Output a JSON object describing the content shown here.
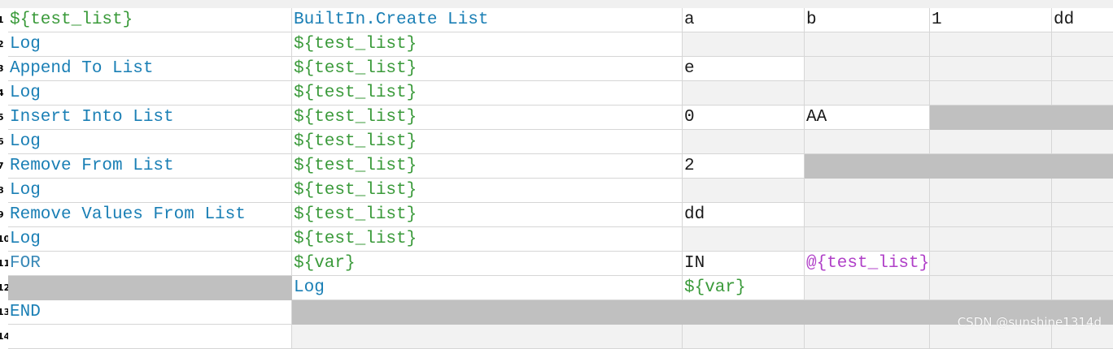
{
  "rows": [
    {
      "num": "1",
      "cells": [
        {
          "text": "${test_list}",
          "style": "var",
          "bg": "white"
        },
        {
          "text": "BuiltIn.Create List",
          "style": "kw",
          "bg": "white"
        },
        {
          "text": "a",
          "style": "plain",
          "bg": "white"
        },
        {
          "text": "b",
          "style": "plain",
          "bg": "white"
        },
        {
          "text": "1",
          "style": "plain",
          "bg": "white"
        },
        {
          "text": "dd",
          "style": "plain",
          "bg": "white"
        }
      ]
    },
    {
      "num": "2",
      "cells": [
        {
          "text": "Log",
          "style": "kw",
          "bg": "white"
        },
        {
          "text": "${test_list}",
          "style": "var",
          "bg": "white"
        },
        {
          "text": "",
          "style": "plain",
          "bg": "light"
        },
        {
          "text": "",
          "style": "plain",
          "bg": "light"
        },
        {
          "text": "",
          "style": "plain",
          "bg": "light"
        },
        {
          "text": "",
          "style": "plain",
          "bg": "light"
        }
      ]
    },
    {
      "num": "3",
      "cells": [
        {
          "text": "Append To List",
          "style": "kw",
          "bg": "white"
        },
        {
          "text": "${test_list}",
          "style": "var",
          "bg": "white"
        },
        {
          "text": "e",
          "style": "plain",
          "bg": "white"
        },
        {
          "text": "",
          "style": "plain",
          "bg": "light"
        },
        {
          "text": "",
          "style": "plain",
          "bg": "light"
        },
        {
          "text": "",
          "style": "plain",
          "bg": "light"
        }
      ]
    },
    {
      "num": "4",
      "cells": [
        {
          "text": "Log",
          "style": "kw",
          "bg": "white"
        },
        {
          "text": "${test_list}",
          "style": "var",
          "bg": "white"
        },
        {
          "text": "",
          "style": "plain",
          "bg": "light"
        },
        {
          "text": "",
          "style": "plain",
          "bg": "light"
        },
        {
          "text": "",
          "style": "plain",
          "bg": "light"
        },
        {
          "text": "",
          "style": "plain",
          "bg": "light"
        }
      ]
    },
    {
      "num": "5",
      "cells": [
        {
          "text": "Insert Into List",
          "style": "kw",
          "bg": "white"
        },
        {
          "text": "${test_list}",
          "style": "var",
          "bg": "white"
        },
        {
          "text": "0",
          "style": "plain",
          "bg": "white"
        },
        {
          "text": "AA",
          "style": "plain",
          "bg": "white"
        },
        {
          "text": "",
          "style": "plain",
          "bg": "grey"
        },
        {
          "text": "",
          "style": "plain",
          "bg": "grey"
        }
      ]
    },
    {
      "num": "6",
      "cells": [
        {
          "text": "Log",
          "style": "kw",
          "bg": "white"
        },
        {
          "text": "${test_list}",
          "style": "var",
          "bg": "white"
        },
        {
          "text": "",
          "style": "plain",
          "bg": "light"
        },
        {
          "text": "",
          "style": "plain",
          "bg": "light"
        },
        {
          "text": "",
          "style": "plain",
          "bg": "light"
        },
        {
          "text": "",
          "style": "plain",
          "bg": "light"
        }
      ]
    },
    {
      "num": "7",
      "cells": [
        {
          "text": "Remove From List",
          "style": "kw",
          "bg": "white"
        },
        {
          "text": "${test_list}",
          "style": "var",
          "bg": "white"
        },
        {
          "text": "2",
          "style": "plain",
          "bg": "white"
        },
        {
          "text": "",
          "style": "plain",
          "bg": "grey"
        },
        {
          "text": "",
          "style": "plain",
          "bg": "grey"
        },
        {
          "text": "",
          "style": "plain",
          "bg": "grey"
        }
      ]
    },
    {
      "num": "8",
      "cells": [
        {
          "text": "Log",
          "style": "kw",
          "bg": "white"
        },
        {
          "text": "${test_list}",
          "style": "var",
          "bg": "white"
        },
        {
          "text": "",
          "style": "plain",
          "bg": "light"
        },
        {
          "text": "",
          "style": "plain",
          "bg": "light"
        },
        {
          "text": "",
          "style": "plain",
          "bg": "light"
        },
        {
          "text": "",
          "style": "plain",
          "bg": "light"
        }
      ]
    },
    {
      "num": "9",
      "cells": [
        {
          "text": "Remove Values From List",
          "style": "kw",
          "bg": "white"
        },
        {
          "text": "${test_list}",
          "style": "var",
          "bg": "white"
        },
        {
          "text": "dd",
          "style": "plain",
          "bg": "white"
        },
        {
          "text": "",
          "style": "plain",
          "bg": "light"
        },
        {
          "text": "",
          "style": "plain",
          "bg": "light"
        },
        {
          "text": "",
          "style": "plain",
          "bg": "light"
        }
      ]
    },
    {
      "num": "10",
      "cells": [
        {
          "text": "Log",
          "style": "kw",
          "bg": "white"
        },
        {
          "text": "${test_list}",
          "style": "var",
          "bg": "white"
        },
        {
          "text": "",
          "style": "plain",
          "bg": "light"
        },
        {
          "text": "",
          "style": "plain",
          "bg": "light"
        },
        {
          "text": "",
          "style": "plain",
          "bg": "light"
        },
        {
          "text": "",
          "style": "plain",
          "bg": "light"
        }
      ]
    },
    {
      "num": "11",
      "cells": [
        {
          "text": "FOR",
          "style": "for",
          "bg": "white"
        },
        {
          "text": "${var}",
          "style": "var",
          "bg": "white"
        },
        {
          "text": "IN",
          "style": "plain",
          "bg": "white"
        },
        {
          "text": "@{test_list}",
          "style": "lst",
          "bg": "white"
        },
        {
          "text": "",
          "style": "plain",
          "bg": "light"
        },
        {
          "text": "",
          "style": "plain",
          "bg": "light"
        }
      ]
    },
    {
      "num": "12",
      "cells": [
        {
          "text": "",
          "style": "plain",
          "bg": "grey"
        },
        {
          "text": "Log",
          "style": "kw",
          "bg": "white"
        },
        {
          "text": "${var}",
          "style": "var",
          "bg": "white"
        },
        {
          "text": "",
          "style": "plain",
          "bg": "light"
        },
        {
          "text": "",
          "style": "plain",
          "bg": "light"
        },
        {
          "text": "",
          "style": "plain",
          "bg": "light"
        }
      ]
    },
    {
      "num": "13",
      "cells": [
        {
          "text": "END",
          "style": "kw",
          "bg": "white"
        },
        {
          "text": "",
          "style": "plain",
          "bg": "grey"
        },
        {
          "text": "",
          "style": "plain",
          "bg": "grey"
        },
        {
          "text": "",
          "style": "plain",
          "bg": "grey"
        },
        {
          "text": "",
          "style": "plain",
          "bg": "grey"
        },
        {
          "text": "",
          "style": "plain",
          "bg": "grey"
        }
      ]
    },
    {
      "num": "14",
      "cells": [
        {
          "text": "",
          "style": "plain",
          "bg": "white"
        },
        {
          "text": "",
          "style": "plain",
          "bg": "light"
        },
        {
          "text": "",
          "style": "plain",
          "bg": "light"
        },
        {
          "text": "",
          "style": "plain",
          "bg": "light"
        },
        {
          "text": "",
          "style": "plain",
          "bg": "light"
        },
        {
          "text": "",
          "style": "plain",
          "bg": "light"
        }
      ]
    }
  ],
  "colors": {
    "keyword": "#1a7fb5",
    "variable": "#3a9a3a",
    "list_variable": "#b040c8",
    "disabled_cell": "#c0c0c0",
    "empty_cell": "#f2f2f2"
  },
  "watermark": "CSDN @sunshine1314d"
}
